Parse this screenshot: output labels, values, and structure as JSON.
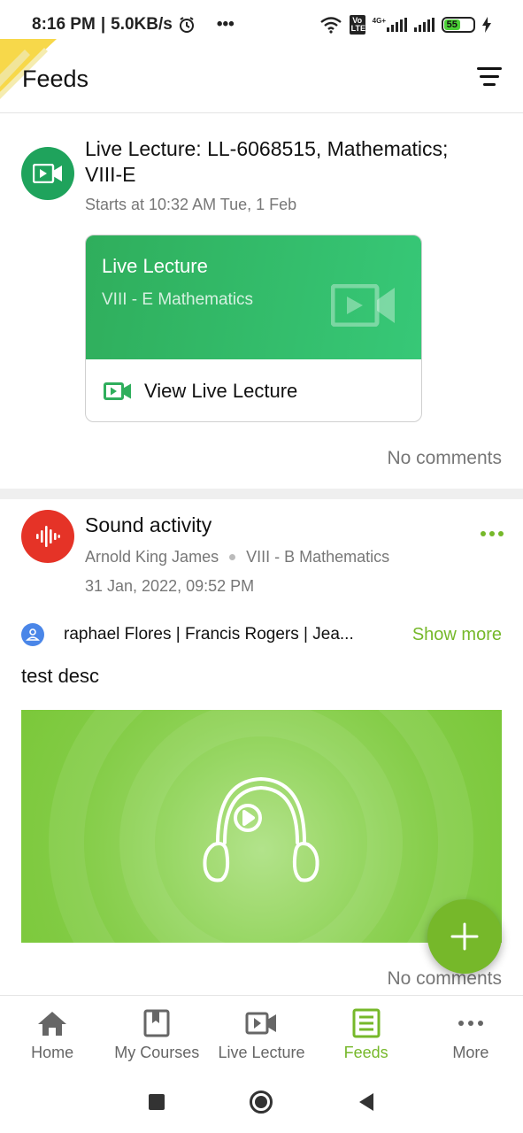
{
  "status_bar": {
    "time": "8:16 PM",
    "speed": "5.0KB/s",
    "dots": "•••",
    "battery": "55",
    "volte": "Vo LTE",
    "network": "4G+"
  },
  "header": {
    "title": "Feeds"
  },
  "feeds": [
    {
      "title": "Live Lecture: LL-6068515, Mathematics; VIII-E",
      "starts": "Starts at 10:32 AM Tue, 1 Feb",
      "card_title": "Live Lecture",
      "card_subtitle": "VIII - E Mathematics",
      "card_link": "View Live Lecture",
      "comments": "No comments",
      "accent": "#2fae5c"
    },
    {
      "title": "Sound activity",
      "author": "Arnold King James",
      "class": "VIII - B Mathematics",
      "date": "31 Jan, 2022, 09:52 PM",
      "recipients": "raphael Flores  |  Francis Rogers  |  Jea...",
      "show_more": "Show more",
      "description": "test desc",
      "comments": "No comments",
      "accent": "#e53327"
    }
  ],
  "bottom_nav": [
    {
      "label": "Home",
      "icon": "home-icon"
    },
    {
      "label": "My Courses",
      "icon": "book-icon"
    },
    {
      "label": "Live Lecture",
      "icon": "video-icon"
    },
    {
      "label": "Feeds",
      "icon": "feeds-icon",
      "active": true
    },
    {
      "label": "More",
      "icon": "more-icon"
    }
  ],
  "theme": {
    "accent_green": "#76b82a",
    "live_green": "#2fae5c",
    "sound_red": "#e53327"
  }
}
